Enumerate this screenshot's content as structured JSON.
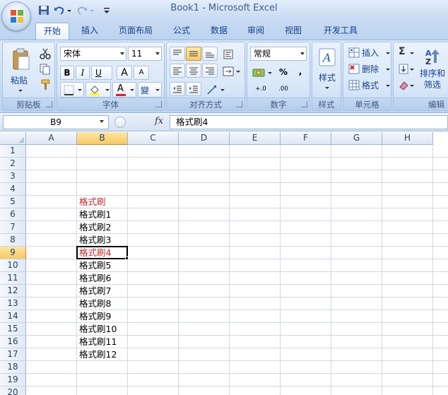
{
  "window": {
    "title": "Book1 - Microsoft Excel"
  },
  "quick_access": {
    "icons": [
      "save-icon",
      "undo-icon",
      "redo-icon",
      "customize-icon"
    ]
  },
  "tabs": [
    {
      "label": "开始",
      "active": true
    },
    {
      "label": "插入"
    },
    {
      "label": "页面布局"
    },
    {
      "label": "公式"
    },
    {
      "label": "数据"
    },
    {
      "label": "审阅"
    },
    {
      "label": "视图"
    },
    {
      "label": "开发工具"
    }
  ],
  "ribbon": {
    "clipboard": {
      "label": "剪贴板",
      "paste_label": "粘贴"
    },
    "font": {
      "label": "字体",
      "font_name": "宋体",
      "font_size": "11",
      "bold": "B",
      "italic": "I",
      "underline": "U",
      "grow": "A",
      "shrink": "A",
      "font_color_letter": "A",
      "phonetic": "變"
    },
    "alignment": {
      "label": "对齐方式"
    },
    "number": {
      "label": "数字",
      "format": "常规",
      "percent": "%",
      "comma": ",",
      "inc_decimal": "+.0",
      "dec_decimal": ".00"
    },
    "styles": {
      "label": "样式",
      "styles_label": "样式"
    },
    "cells": {
      "label": "单元格",
      "insert_label": "插入",
      "delete_label": "删除",
      "format_label": "格式"
    },
    "editing": {
      "label": "编辑",
      "sort_label_1": "排序和",
      "sort_label_2": "筛选"
    }
  },
  "formula_bar": {
    "name_box": "B9",
    "fx": "fx",
    "content": "格式刷4"
  },
  "sheet": {
    "columns": [
      "A",
      "B",
      "C",
      "D",
      "E",
      "F",
      "G",
      "H"
    ],
    "selected_column": "B",
    "rows": [
      "1",
      "2",
      "3",
      "4",
      "5",
      "6",
      "7",
      "8",
      "9",
      "10",
      "11",
      "12",
      "13",
      "14",
      "15",
      "16",
      "17",
      "18",
      "19",
      "20"
    ],
    "selected_row": "9",
    "active_cell": "B9",
    "cells": [
      {
        "ref": "B5",
        "value": "格式刷",
        "color": "#c0282e"
      },
      {
        "ref": "B6",
        "value": "格式刷1"
      },
      {
        "ref": "B7",
        "value": "格式刷2"
      },
      {
        "ref": "B8",
        "value": "格式刷3"
      },
      {
        "ref": "B9",
        "value": "格式刷4",
        "color": "#c0282e"
      },
      {
        "ref": "B10",
        "value": "格式刷5"
      },
      {
        "ref": "B11",
        "value": "格式刷6"
      },
      {
        "ref": "B12",
        "value": "格式刷7"
      },
      {
        "ref": "B13",
        "value": "格式刷8"
      },
      {
        "ref": "B14",
        "value": "格式刷9"
      },
      {
        "ref": "B15",
        "value": "格式刷10"
      },
      {
        "ref": "B16",
        "value": "格式刷11"
      },
      {
        "ref": "B17",
        "value": "格式刷12"
      }
    ]
  },
  "colors": {
    "accent": "#15428b",
    "ribbon": "#c9dcf3",
    "selection": "#f8c866",
    "red_text": "#c0282e",
    "font_color_bar": "#e02020",
    "fill_color_bar": "#ffff00"
  }
}
